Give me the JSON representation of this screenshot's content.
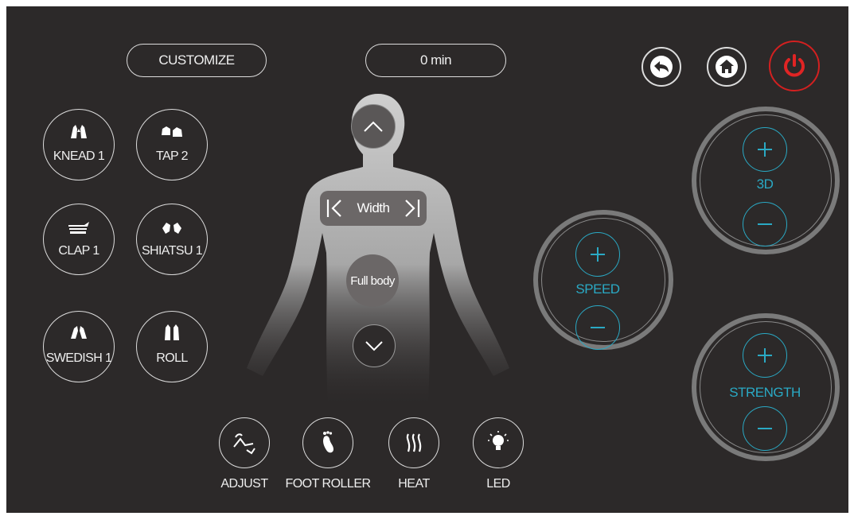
{
  "header": {
    "customize_label": "CUSTOMIZE",
    "timer_label": "0 min"
  },
  "top_buttons": {
    "back_icon": "back-arrow-icon",
    "home_icon": "home-icon",
    "power_icon": "power-icon",
    "power_color": "#e02424"
  },
  "modes": [
    {
      "label": "KNEAD 1",
      "icon": "knead-hands-icon"
    },
    {
      "label": "TAP 2",
      "icon": "tap-hands-icon"
    },
    {
      "label": "CLAP 1",
      "icon": "clap-hand-icon"
    },
    {
      "label": "SHIATSU 1",
      "icon": "shiatsu-hands-icon"
    },
    {
      "label": "SWEDISH 1",
      "icon": "swedish-hands-icon"
    },
    {
      "label": "ROLL",
      "icon": "roll-icon"
    }
  ],
  "body": {
    "width_label": "Width",
    "area_label": "Full body"
  },
  "controls": {
    "speed_label": "SPEED",
    "depth_label": "3D",
    "strength_label": "STRENGTH",
    "accent_color": "#2aa9c4"
  },
  "bottom": [
    {
      "label": "ADJUST",
      "icon": "recline-adjust-icon"
    },
    {
      "label": "FOOT ROLLER",
      "icon": "foot-icon"
    },
    {
      "label": "HEAT",
      "icon": "heat-waves-icon"
    },
    {
      "label": "LED",
      "icon": "light-bulb-icon"
    }
  ]
}
